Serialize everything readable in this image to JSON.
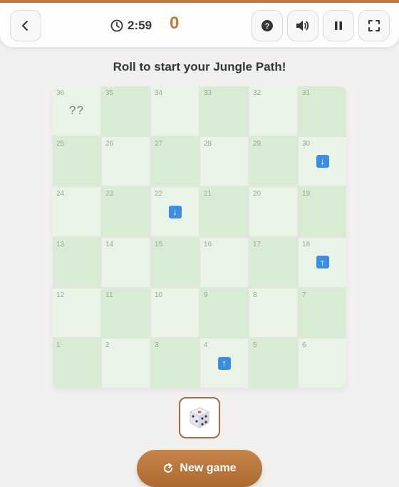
{
  "header": {
    "back_icon": "chevron-left-icon",
    "timer": "2:59",
    "score": "0",
    "help_icon": "help-icon",
    "sound_icon": "speaker-icon",
    "pause_icon": "pause-icon",
    "fullscreen_icon": "fullscreen-icon"
  },
  "status": "Roll to start your Jungle Path!",
  "board": {
    "rows": [
      [
        {
          "n": "36",
          "tone": "light",
          "mark": "??"
        },
        {
          "n": "35",
          "tone": "dark"
        },
        {
          "n": "34",
          "tone": "light"
        },
        {
          "n": "33",
          "tone": "dark"
        },
        {
          "n": "32",
          "tone": "light"
        },
        {
          "n": "31",
          "tone": "dark"
        }
      ],
      [
        {
          "n": "25",
          "tone": "dark"
        },
        {
          "n": "26",
          "tone": "light"
        },
        {
          "n": "27",
          "tone": "dark"
        },
        {
          "n": "28",
          "tone": "light"
        },
        {
          "n": "29",
          "tone": "dark"
        },
        {
          "n": "30",
          "tone": "light",
          "arrow": "down"
        }
      ],
      [
        {
          "n": "24",
          "tone": "light"
        },
        {
          "n": "23",
          "tone": "dark"
        },
        {
          "n": "22",
          "tone": "light",
          "arrow": "down"
        },
        {
          "n": "21",
          "tone": "dark"
        },
        {
          "n": "20",
          "tone": "light"
        },
        {
          "n": "19",
          "tone": "dark"
        }
      ],
      [
        {
          "n": "13",
          "tone": "dark"
        },
        {
          "n": "14",
          "tone": "light"
        },
        {
          "n": "15",
          "tone": "dark"
        },
        {
          "n": "16",
          "tone": "light"
        },
        {
          "n": "17",
          "tone": "dark"
        },
        {
          "n": "18",
          "tone": "light",
          "arrow": "up"
        }
      ],
      [
        {
          "n": "12",
          "tone": "light"
        },
        {
          "n": "11",
          "tone": "dark"
        },
        {
          "n": "10",
          "tone": "light"
        },
        {
          "n": "9",
          "tone": "dark"
        },
        {
          "n": "8",
          "tone": "light"
        },
        {
          "n": "7",
          "tone": "dark"
        }
      ],
      [
        {
          "n": "1",
          "tone": "dark"
        },
        {
          "n": "2",
          "tone": "light"
        },
        {
          "n": "3",
          "tone": "dark"
        },
        {
          "n": "4",
          "tone": "light",
          "arrow": "up"
        },
        {
          "n": "5",
          "tone": "dark"
        },
        {
          "n": "6",
          "tone": "light"
        }
      ]
    ]
  },
  "dice": {
    "icon": "dice-icon"
  },
  "new_game": {
    "label": "New game",
    "icon": "restart-icon"
  },
  "colors": {
    "accent": "#c27a3e",
    "cell_light": "#e9f4e6",
    "cell_dark": "#d7ecd3",
    "arrow": "#3d8de3"
  }
}
